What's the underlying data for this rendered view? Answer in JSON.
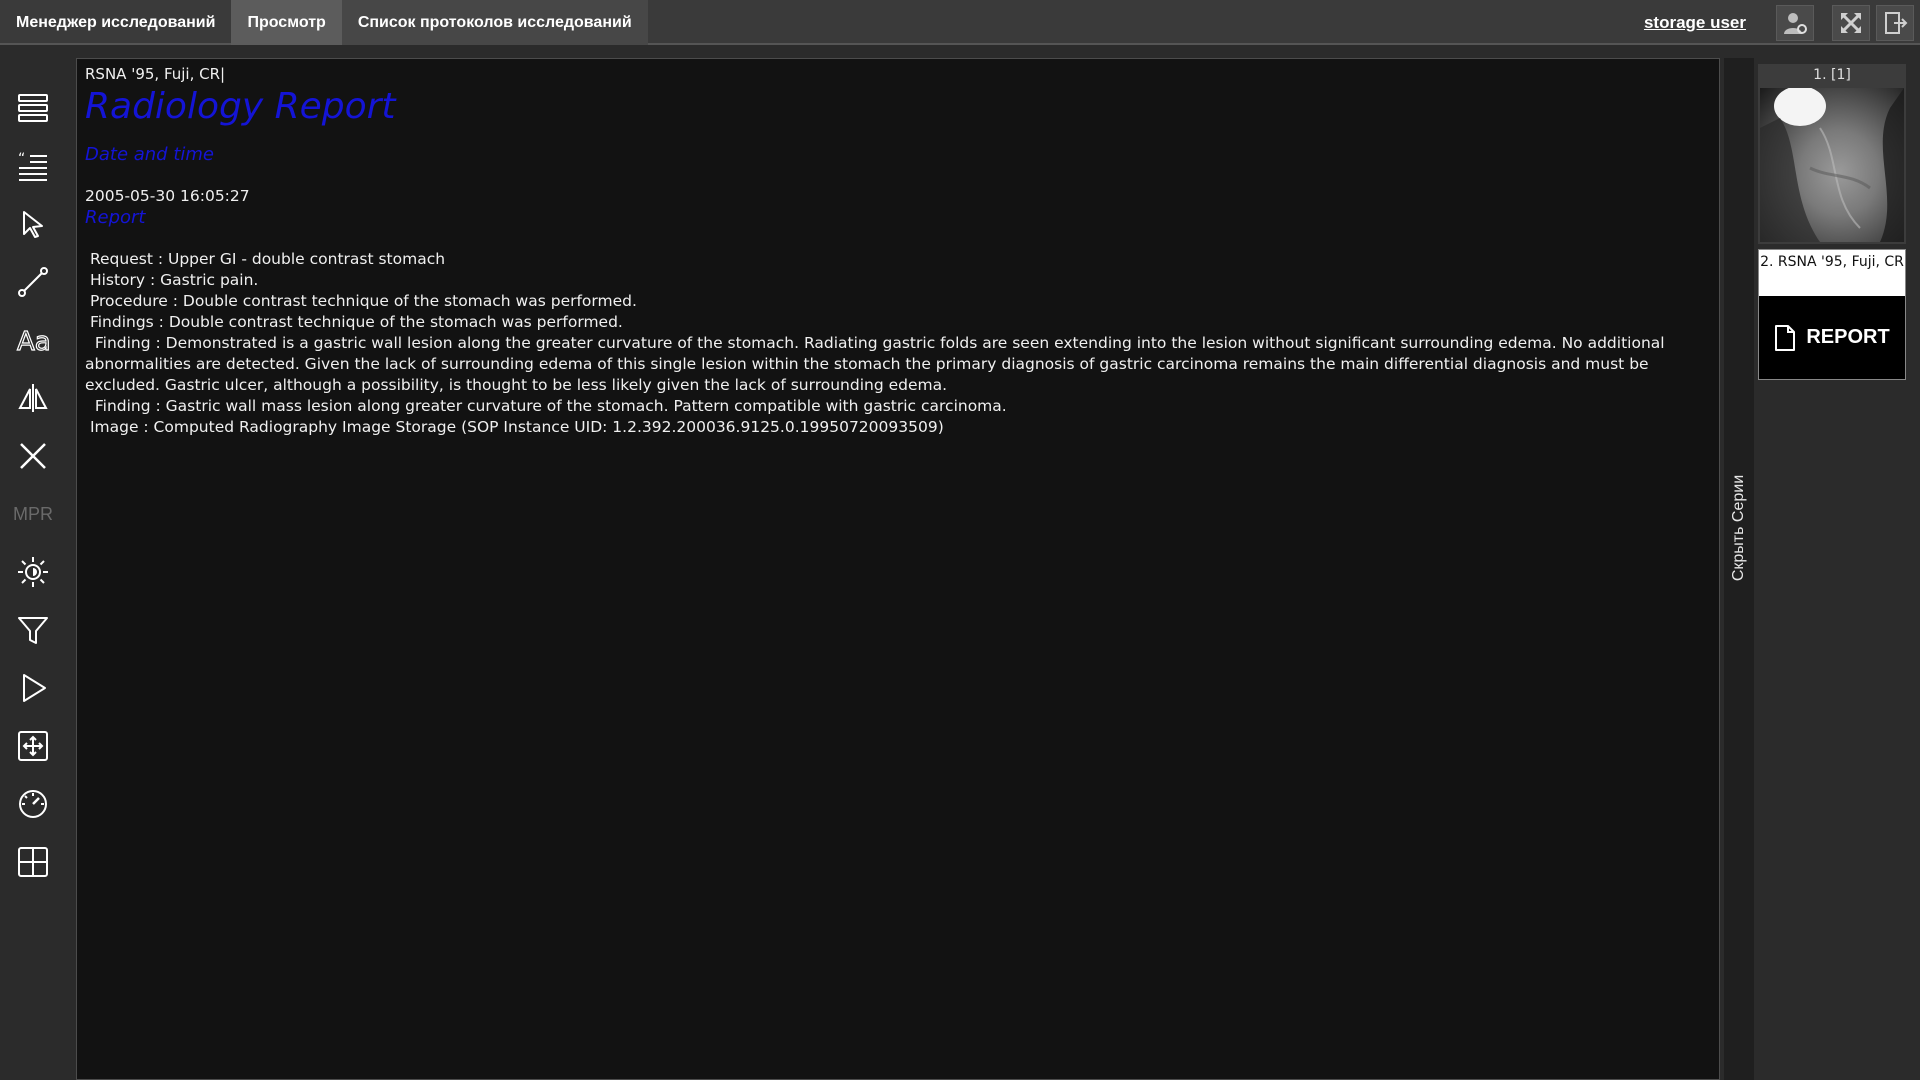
{
  "topbar": {
    "tabs": [
      {
        "label": "Менеджер исследований"
      },
      {
        "label": "Просмотр"
      },
      {
        "label": "Список протоколов исследований"
      }
    ],
    "user": "storage user"
  },
  "toolbar": {
    "mpr_label": "MPR"
  },
  "viewer": {
    "header": "RSNA '95, Fuji, CR|",
    "title": "Radiology Report",
    "date_heading": "Date and time",
    "date_value": "2005-05-30 16:05:27",
    "report_heading": "Report",
    "lines": [
      " Request : Upper GI - double contrast stomach",
      " History : Gastric pain.",
      " Procedure : Double contrast technique of the stomach was performed.",
      " Findings : Double contrast technique of the stomach was performed.",
      "  Finding : Demonstrated is a gastric wall lesion along the greater curvature of the stomach. Radiating gastric folds are seen extending into the lesion without significant surrounding edema. No additional abnormalities are detected. Given the lack of surrounding edema of this single lesion within the stomach the primary diagnosis of gastric carcinoma remains the main differential diagnosis and must be excluded. Gastric ulcer, although a possibility, is thought to be less likely given the lack of surrounding edema.",
      "  Finding : Gastric wall mass lesion along greater curvature of the stomach. Pattern compatible with gastric carcinoma.",
      " Image : Computed Radiography Image Storage (SOP Instance UID: 1.2.392.200036.9125.0.19950720093509)"
    ]
  },
  "series_panel": {
    "hide_label": "Скрыть Серии",
    "items": [
      {
        "label": "1. [1]"
      },
      {
        "label": "2. RSNA '95, Fuji, CR",
        "badge": "REPORT"
      }
    ]
  },
  "colors": {
    "accent_blue": "#1414d6",
    "viewer_bg": "#121212",
    "topbar_bg": "#3a3a3a",
    "active_tab": "#5c5c5c"
  }
}
